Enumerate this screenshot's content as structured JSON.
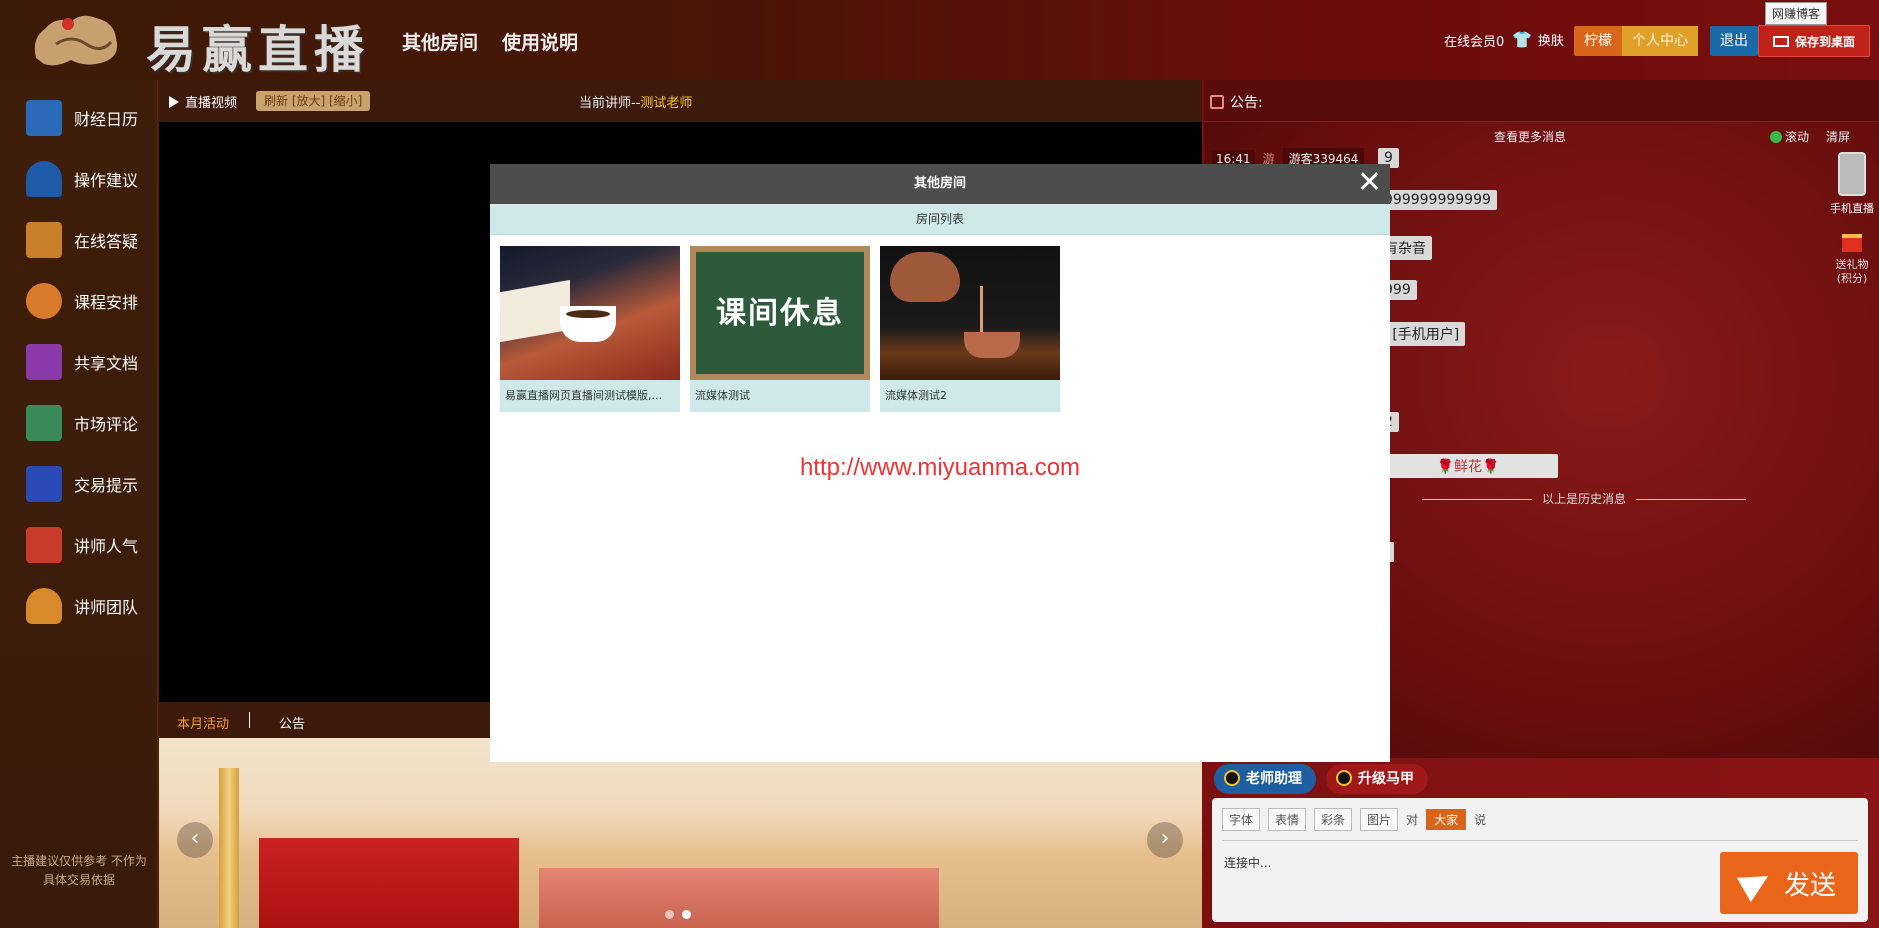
{
  "header": {
    "logo_text": "易赢直播",
    "nav": [
      "其他房间",
      "使用说明"
    ],
    "online_label": "在线会员0",
    "skin_label": "换肤",
    "user_name": "柠檬",
    "personal_center": "个人中心",
    "logout": "退出",
    "save_desktop": "保存到桌面",
    "tooltip": "网赚博客"
  },
  "sidebar": {
    "items": [
      {
        "label": "财经日历",
        "icon": "calendar-icon",
        "color": "#2a6ab8"
      },
      {
        "label": "操作建议",
        "icon": "bell-icon",
        "color": "#1e5aa8"
      },
      {
        "label": "在线答疑",
        "icon": "document-icon",
        "color": "#c8802a"
      },
      {
        "label": "课程安排",
        "icon": "teacher-icon",
        "color": "#d87a2a"
      },
      {
        "label": "共享文档",
        "icon": "chart-icon",
        "color": "#8a3aa8"
      },
      {
        "label": "市场评论",
        "icon": "books-icon",
        "color": "#3a8a5a"
      },
      {
        "label": "交易提示",
        "icon": "envelope-icon",
        "color": "#2a4ab8"
      },
      {
        "label": "讲师人气",
        "icon": "thumbs-up-icon",
        "color": "#c83a2a"
      },
      {
        "label": "讲师团队",
        "icon": "person-icon",
        "color": "#d88a2a"
      }
    ],
    "note_line1": "主播建议仅供参考 不作为",
    "note_line2": "具体交易依据"
  },
  "video": {
    "label": "直播视频",
    "refresh": "刷新 [放大] [缩小]",
    "teacher_prefix": "当前讲师--",
    "teacher_name": "测试老师"
  },
  "bottom_tabs": {
    "active": "本月活动",
    "other": "公告"
  },
  "right": {
    "announcement": "公告:",
    "more_messages": "查看更多消息",
    "scroll": "滚动",
    "clear": "清屏",
    "mobile_live": "手机直播",
    "gift_line1": "送礼物",
    "gift_line2": "(积分)",
    "history": "以上是历史消息",
    "msg_time": "16:41",
    "msg_user": "游客339464",
    "bubbles": [
      "9",
      "999999999999",
      "有杂音",
      "999",
      "l [手机用户]",
      "2",
      "🌹鲜花🌹",
      "l"
    ]
  },
  "composer": {
    "role1": "老师助理",
    "role2": "升级马甲",
    "font": "字体",
    "emoji": "表情",
    "color_bar": "彩条",
    "image": "图片",
    "to": "对",
    "target": "大家",
    "say": "说",
    "status": "连接中...",
    "send": "发送"
  },
  "modal": {
    "title": "其他房间",
    "subtitle": "房间列表",
    "close": "✕",
    "rooms": [
      {
        "caption": "易赢直播网页直播间测试模版,..."
      },
      {
        "caption": "流媒体测试",
        "thumb_text": "课间休息"
      },
      {
        "caption": "流媒体测试2"
      }
    ],
    "watermark": "http://www.miyuanma.com"
  }
}
